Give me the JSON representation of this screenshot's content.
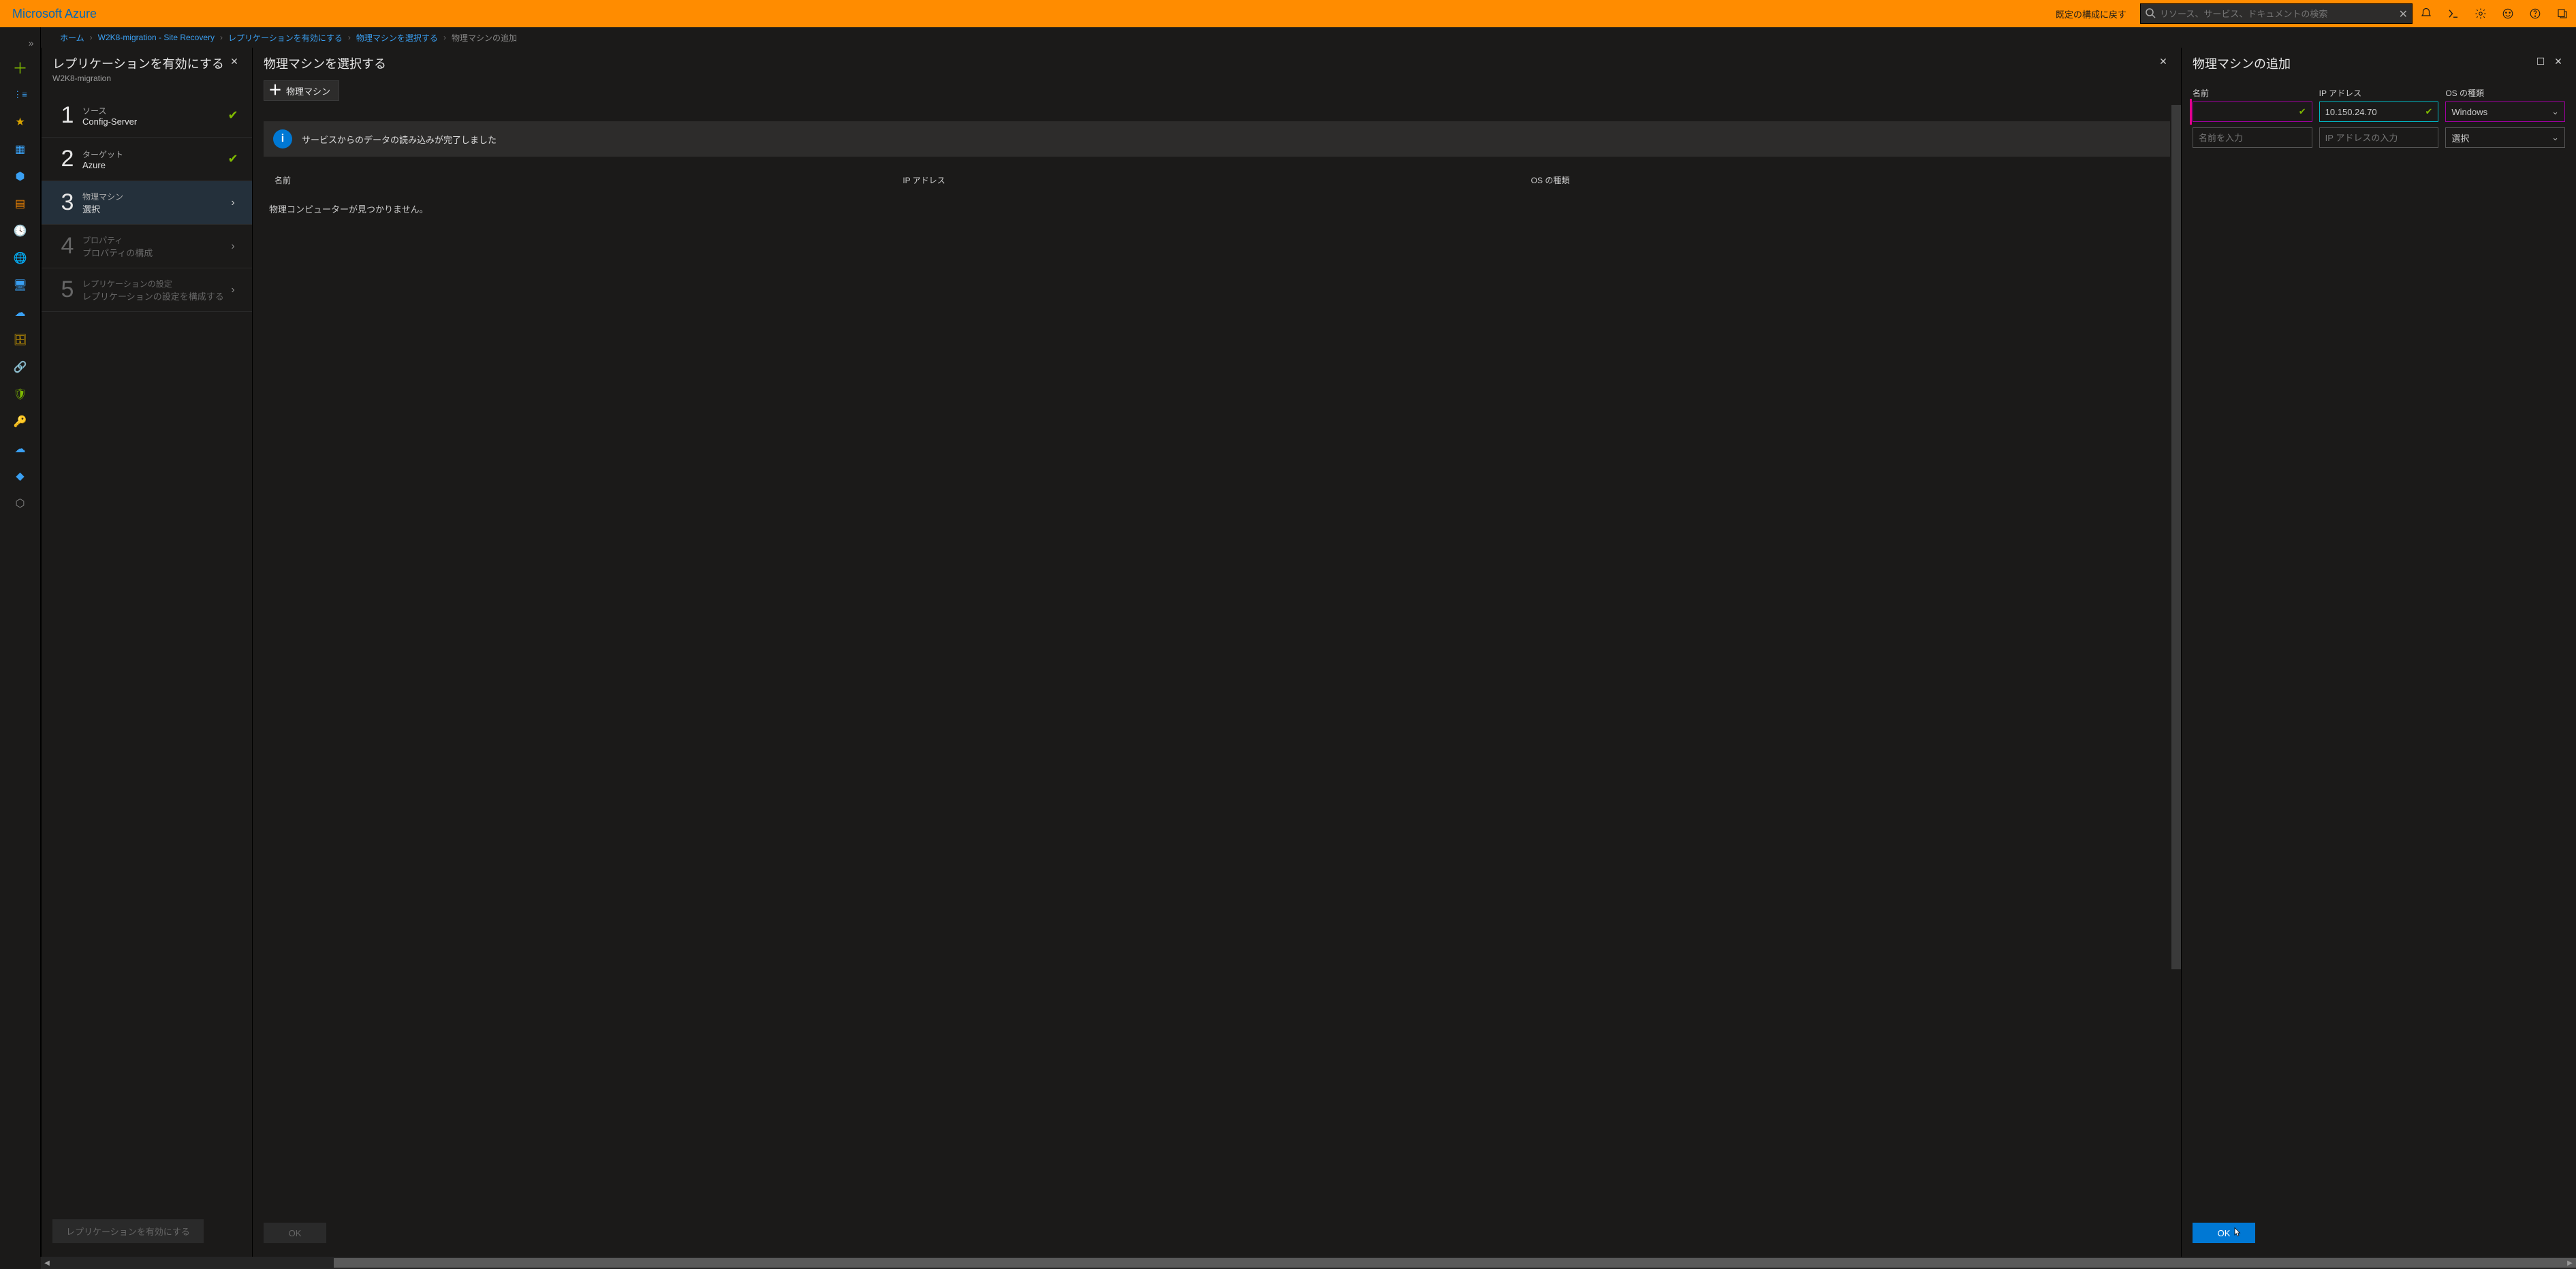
{
  "topbar": {
    "logo": "Microsoft Azure",
    "reset": "既定の構成に戻す",
    "search_placeholder": "リソース、サービス、ドキュメントの検索"
  },
  "breadcrumbs": {
    "home": "ホーム",
    "vault": "W2K8-migration - Site Recovery",
    "enable": "レプリケーションを有効にする",
    "select": "物理マシンを選択する",
    "add": "物理マシンの追加"
  },
  "leftrail": [
    {
      "glyph": "≫",
      "name": "leftrail-expand"
    },
    {
      "glyph": "＋",
      "name": "leftrail-create"
    },
    {
      "glyph": "⋮≡",
      "name": "leftrail-all"
    },
    {
      "glyph": "★",
      "name": "leftrail-favorites"
    },
    {
      "glyph": "▦",
      "name": "leftrail-dashboards"
    },
    {
      "glyph": "◍",
      "name": "leftrail-resource-groups"
    },
    {
      "glyph": "▤",
      "name": "leftrail-all-resources"
    },
    {
      "glyph": "🕓",
      "name": "leftrail-recent"
    },
    {
      "glyph": "🌐",
      "name": "leftrail-app-services"
    },
    {
      "glyph": "🖥",
      "name": "leftrail-virtual-machines"
    },
    {
      "glyph": "☁",
      "name": "leftrail-cloud-services"
    },
    {
      "glyph": "🗄",
      "name": "leftrail-sql"
    },
    {
      "glyph": "🔗",
      "name": "leftrail-connections"
    },
    {
      "glyph": "🛡",
      "name": "leftrail-security"
    },
    {
      "glyph": "🔑",
      "name": "leftrail-keys"
    },
    {
      "glyph": "☁",
      "name": "leftrail-subscriptions"
    },
    {
      "glyph": "◆",
      "name": "leftrail-azure-ad"
    },
    {
      "glyph": "⬡",
      "name": "leftrail-monitor"
    }
  ],
  "blade1": {
    "title": "レプリケーションを有効にする",
    "subtitle": "W2K8-migration",
    "steps": [
      {
        "num": "1",
        "lab1": "ソース",
        "lab2": "Config-Server",
        "done": true
      },
      {
        "num": "2",
        "lab1": "ターゲット",
        "lab2": "Azure",
        "done": true
      },
      {
        "num": "3",
        "lab1": "物理マシン",
        "lab2": "選択",
        "active": true
      },
      {
        "num": "4",
        "lab1": "プロパティ",
        "lab2": "プロパティの構成",
        "dim": true
      },
      {
        "num": "5",
        "lab1": "レプリケーションの設定",
        "lab2": "レプリケーションの設定を構成する",
        "dim": true
      }
    ],
    "footer_btn": "レプリケーションを有効にする"
  },
  "blade2": {
    "title": "物理マシンを選択する",
    "add_btn": "物理マシン",
    "info": "サービスからのデータの読み込みが完了しました",
    "cols": {
      "name": "名前",
      "ip": "IP アドレス",
      "os": "OS の種類"
    },
    "empty": "物理コンピューターが見つかりません。",
    "ok": "OK"
  },
  "blade3": {
    "title": "物理マシンの追加",
    "cols": {
      "name": "名前",
      "ip": "IP アドレス",
      "os": "OS の種類"
    },
    "row1": {
      "name": "",
      "ip": "10.150.24.70",
      "os": "Windows"
    },
    "row2": {
      "name_ph": "名前を入力",
      "ip_ph": "IP アドレスの入力",
      "os": "選択"
    },
    "ok": "OK"
  }
}
